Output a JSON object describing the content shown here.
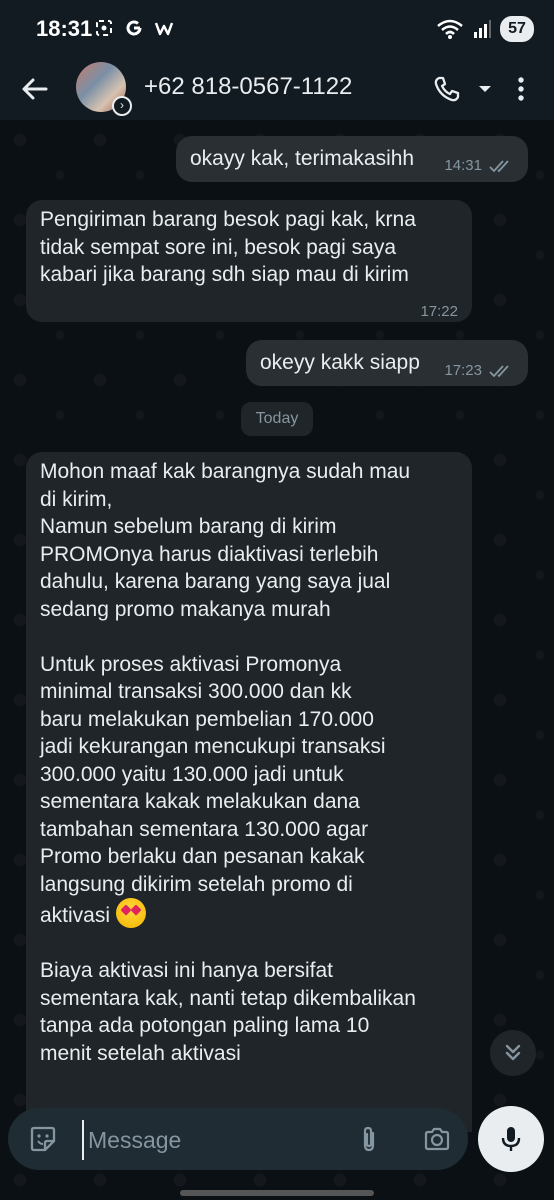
{
  "status_bar": {
    "time": "18:31",
    "notification_icons": [
      "screenshot-icon",
      "google-icon",
      "w-icon"
    ],
    "battery": "57",
    "right_icons": [
      "wifi-icon",
      "signal-icon"
    ]
  },
  "header": {
    "contact_name": "+62 818-0567-1122",
    "icons": [
      "back-arrow-icon",
      "phone-icon",
      "dropdown-icon",
      "more-vert-icon"
    ]
  },
  "messages": [
    {
      "direction": "out",
      "text": "okayy kak, terimakasihh",
      "time": "14:31",
      "read": true
    },
    {
      "direction": "in",
      "text": "Pengiriman barang besok pagi kak, krna\ntidak sempat sore ini, besok pagi saya\nkabari jika barang sdh siap mau di kirim",
      "time": "17:22"
    },
    {
      "direction": "out",
      "text": "okeyy kakk siapp",
      "time": "17:23",
      "read": true
    }
  ],
  "date_separator": "Today",
  "long_message": {
    "part1": "Mohon maaf kak barangnya sudah mau\ndi kirim,\nNamun sebelum barang di kirim\nPROMOnya harus diaktivasi terlebih\ndahulu, karena barang yang saya jual\nsedang promo makanya murah\n\nUntuk proses aktivasi Promonya\nminimal transaksi 300.000 dan kk\nbaru melakukan pembelian 170.000\njadi kekurangan mencukupi transaksi\n300.000 yaitu 130.000 jadi untuk\nsementara kakak melakukan dana\ntambahan sementara 130.000 agar\nPromo berlaku dan pesanan kakak\nlangsung dikirim setelah promo di\naktivasi",
    "emoji": "smiling-face-with-heart-eyes-icon",
    "part2": "Biaya aktivasi ini hanya bersifat\nsementara kak, nanti tetap dikembalikan\ntanpa ada potongan paling lama 10\nmenit setelah aktivasi"
  },
  "input_bar": {
    "placeholder": "Message",
    "icons": [
      "emoji-sticker-icon",
      "attach-icon",
      "camera-icon",
      "mic-icon"
    ]
  },
  "colors": {
    "background": "#0b1014",
    "header": "#121b22",
    "bubble_out": "#2a2f33",
    "bubble_in": "#1f2528",
    "text": "#e9edef",
    "meta": "#8696a0",
    "input": "#1f2c34"
  }
}
